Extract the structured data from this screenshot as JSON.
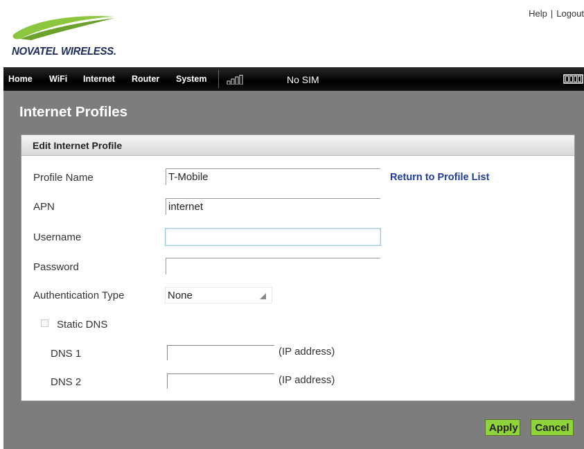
{
  "header": {
    "logo_text": "NOVATEL WIRELESS.",
    "logo_color": "#1c2b59",
    "logo_swoosh_color": "#8cc63f",
    "help_label": "Help",
    "separator": "|",
    "logout_label": "Logout"
  },
  "nav": {
    "items": [
      {
        "label": "Home"
      },
      {
        "label": "WiFi"
      },
      {
        "label": "Internet"
      },
      {
        "label": "Router"
      },
      {
        "label": "System"
      }
    ],
    "sim_status": "No SIM",
    "icons": [
      "signal-icon",
      "battery-icon"
    ]
  },
  "main": {
    "page_title": "Internet Profiles",
    "panel_title": "Edit Internet Profile",
    "return_link": "Return to Profile List",
    "form": {
      "profile_name_label": "Profile Name",
      "profile_name_value": "T-Mobile",
      "apn_label": "APN",
      "apn_value": "internet",
      "username_label": "Username",
      "username_value": "",
      "password_label": "Password",
      "password_value": "",
      "auth_type_label": "Authentication Type",
      "auth_type_value": "None",
      "static_dns_label": "Static DNS",
      "static_dns_checked": false,
      "dns1_label": "DNS 1",
      "dns1_value": "",
      "dns2_label": "DNS 2",
      "dns2_value": "",
      "ip_hint": "(IP address)"
    }
  },
  "buttons": {
    "apply_label": "Apply",
    "cancel_label": "Cancel"
  },
  "colors": {
    "background_gray": "#7d7d7d",
    "button_green": "#8fd33a",
    "link_blue": "#1e3c96",
    "nav_black": "#000000"
  }
}
